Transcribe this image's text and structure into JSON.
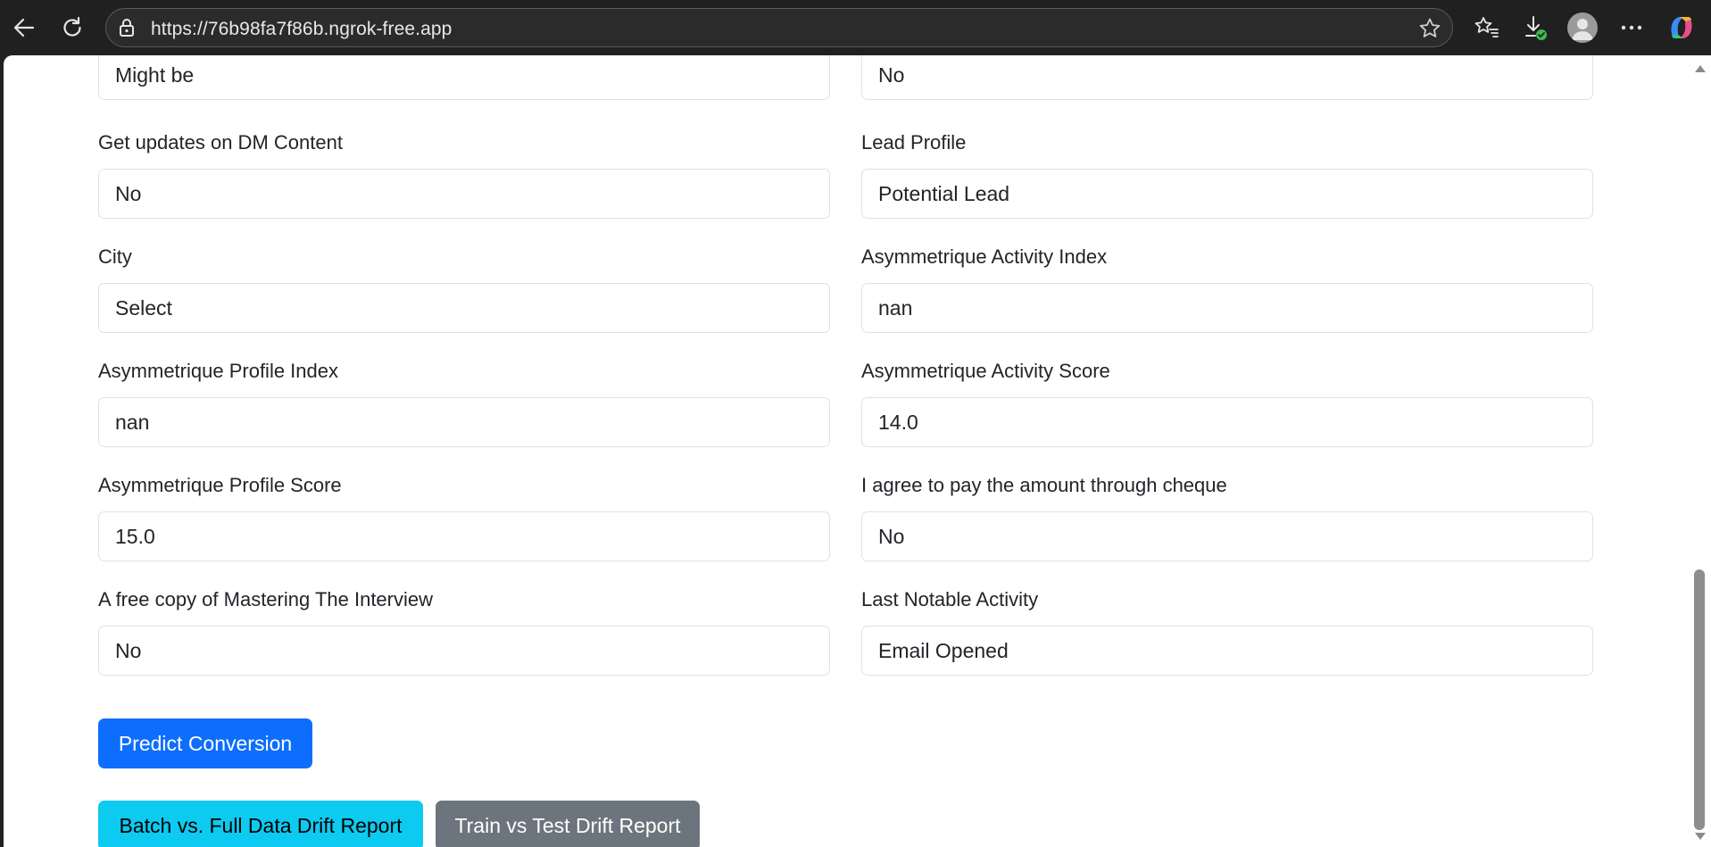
{
  "browser": {
    "url": "https://76b98fa7f86b.ngrok-free.app",
    "icons": [
      "back-arrow-icon",
      "refresh-icon",
      "lock-icon",
      "star-icon",
      "favorites-icon",
      "download-icon",
      "profile-avatar-icon",
      "more-icon",
      "copilot-icon"
    ]
  },
  "form": {
    "fields": [
      {
        "label": "",
        "value": "Might be"
      },
      {
        "label": "",
        "value": "No"
      },
      {
        "label": "Get updates on DM Content",
        "value": "No"
      },
      {
        "label": "Lead Profile",
        "value": "Potential Lead"
      },
      {
        "label": "City",
        "value": "Select"
      },
      {
        "label": "Asymmetrique Activity Index",
        "value": "nan"
      },
      {
        "label": "Asymmetrique Profile Index",
        "value": "nan"
      },
      {
        "label": "Asymmetrique Activity Score",
        "value": "14.0"
      },
      {
        "label": "Asymmetrique Profile Score",
        "value": "15.0"
      },
      {
        "label": "I agree to pay the amount through cheque",
        "value": "No"
      },
      {
        "label": "A free copy of Mastering The Interview",
        "value": "No"
      },
      {
        "label": "Last Notable Activity",
        "value": "Email Opened"
      }
    ],
    "predict_label": "Predict Conversion",
    "batch_report_label": "Batch vs. Full Data Drift Report",
    "train_test_report_label": "Train vs Test Drift Report"
  },
  "colors": {
    "primary": "#0d6efd",
    "info": "#0dcaf0",
    "secondary": "#6c757d"
  }
}
